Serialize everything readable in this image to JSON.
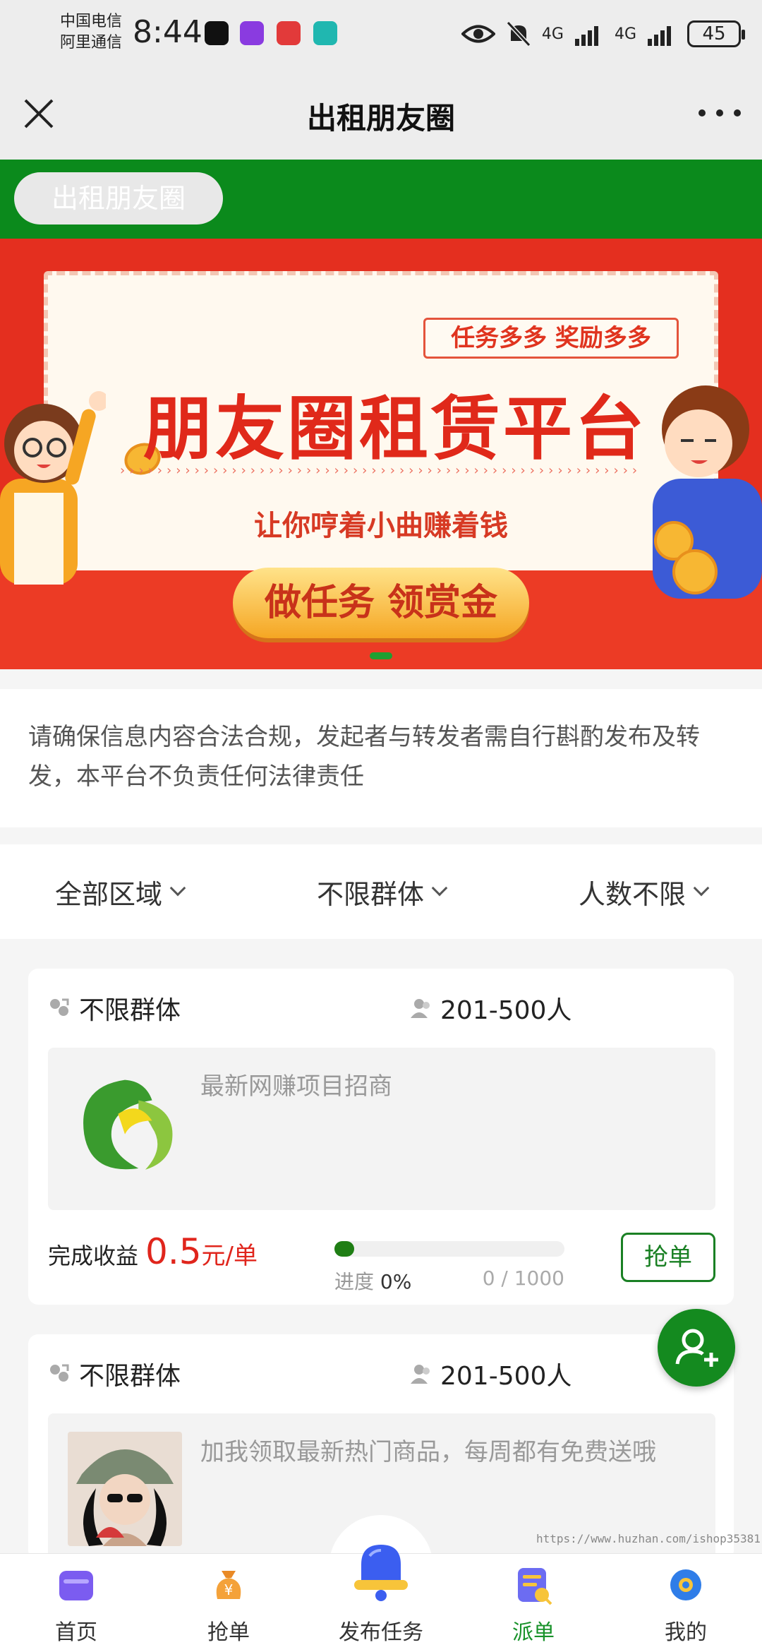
{
  "status_bar": {
    "carrier_line1": "中国电信",
    "carrier_line2": "阿里通信",
    "time": "8:44",
    "network1": "4G",
    "network2": "4G",
    "battery": "45"
  },
  "nav": {
    "title": "出租朋友圈"
  },
  "strip": {
    "pill_label": "出租朋友圈"
  },
  "banner": {
    "tag": "任务多多 奖励多多",
    "title": "朋友圈租赁平台",
    "subtitle": "让你哼着小曲赚着钱",
    "button": "做任务 领赏金"
  },
  "notice": {
    "text": "请确保信息内容合法合规，发起者与转发者需自行斟酌发布及转发，本平台不负责任何法律责任"
  },
  "filters": [
    {
      "label": "全部区域"
    },
    {
      "label": "不限群体"
    },
    {
      "label": "人数不限"
    }
  ],
  "tasks": [
    {
      "group": "不限群体",
      "people": "201-500人",
      "content": "最新网赚项目招商",
      "earn_label": "完成收益",
      "earn_value": "0.5",
      "earn_unit": "元/单",
      "progress_label": "进度",
      "progress_percent": "0%",
      "progress_fraction": 0,
      "progress_count": "0 / 1000",
      "button": "抢单"
    },
    {
      "group": "不限群体",
      "people": "201-500人",
      "content": "加我领取最新热门商品，每周都有免费送哦"
    }
  ],
  "watermark": "https://www.huzhan.com/ishop35381",
  "tabbar": [
    {
      "label": "首页",
      "icon": "home-icon"
    },
    {
      "label": "抢单",
      "icon": "money-bag-icon"
    },
    {
      "label": "发布任务",
      "icon": "bell-icon"
    },
    {
      "label": "派单",
      "icon": "order-icon"
    },
    {
      "label": "我的",
      "icon": "settings-icon"
    }
  ],
  "colors": {
    "brand_green": "#0b8a1c",
    "accent_red": "#e0251c",
    "banner_red": "#e42f1f"
  }
}
